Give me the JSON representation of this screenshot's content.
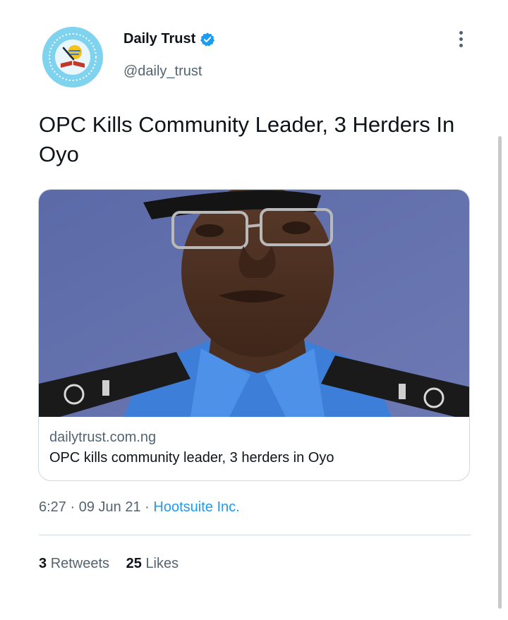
{
  "account": {
    "name": "Daily Trust",
    "handle": "@daily_trust",
    "verified": true,
    "avatar_icon": "daily-trust-logo-icon"
  },
  "tweet": {
    "text": "OPC Kills Community Leader, 3 Herders In Oyo"
  },
  "link_card": {
    "domain": "dailytrust.com.ng",
    "title": "OPC kills community leader, 3 herders in Oyo",
    "image": "police-officer-portrait"
  },
  "meta": {
    "time": "6:27",
    "date": "09 Jun 21",
    "separator": "·",
    "source": "Hootsuite Inc."
  },
  "stats": {
    "retweets_count": "3",
    "retweets_label": "Retweets",
    "likes_count": "25",
    "likes_label": "Likes"
  },
  "colors": {
    "accent": "#1d9bf0",
    "secondary_text": "#536471",
    "avatar_bg": "#7fd3ee"
  }
}
